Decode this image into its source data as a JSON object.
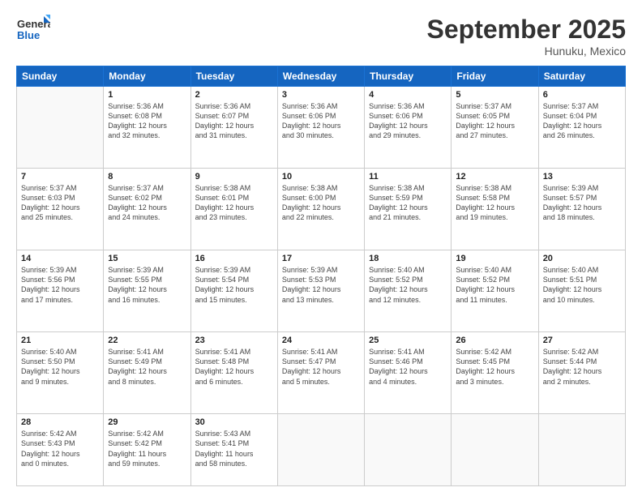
{
  "logo": {
    "line1": "General",
    "line2": "Blue"
  },
  "title": "September 2025",
  "location": "Hunuku, Mexico",
  "days_header": [
    "Sunday",
    "Monday",
    "Tuesday",
    "Wednesday",
    "Thursday",
    "Friday",
    "Saturday"
  ],
  "weeks": [
    [
      {
        "day": "",
        "info": ""
      },
      {
        "day": "1",
        "info": "Sunrise: 5:36 AM\nSunset: 6:08 PM\nDaylight: 12 hours\nand 32 minutes."
      },
      {
        "day": "2",
        "info": "Sunrise: 5:36 AM\nSunset: 6:07 PM\nDaylight: 12 hours\nand 31 minutes."
      },
      {
        "day": "3",
        "info": "Sunrise: 5:36 AM\nSunset: 6:06 PM\nDaylight: 12 hours\nand 30 minutes."
      },
      {
        "day": "4",
        "info": "Sunrise: 5:36 AM\nSunset: 6:06 PM\nDaylight: 12 hours\nand 29 minutes."
      },
      {
        "day": "5",
        "info": "Sunrise: 5:37 AM\nSunset: 6:05 PM\nDaylight: 12 hours\nand 27 minutes."
      },
      {
        "day": "6",
        "info": "Sunrise: 5:37 AM\nSunset: 6:04 PM\nDaylight: 12 hours\nand 26 minutes."
      }
    ],
    [
      {
        "day": "7",
        "info": "Sunrise: 5:37 AM\nSunset: 6:03 PM\nDaylight: 12 hours\nand 25 minutes."
      },
      {
        "day": "8",
        "info": "Sunrise: 5:37 AM\nSunset: 6:02 PM\nDaylight: 12 hours\nand 24 minutes."
      },
      {
        "day": "9",
        "info": "Sunrise: 5:38 AM\nSunset: 6:01 PM\nDaylight: 12 hours\nand 23 minutes."
      },
      {
        "day": "10",
        "info": "Sunrise: 5:38 AM\nSunset: 6:00 PM\nDaylight: 12 hours\nand 22 minutes."
      },
      {
        "day": "11",
        "info": "Sunrise: 5:38 AM\nSunset: 5:59 PM\nDaylight: 12 hours\nand 21 minutes."
      },
      {
        "day": "12",
        "info": "Sunrise: 5:38 AM\nSunset: 5:58 PM\nDaylight: 12 hours\nand 19 minutes."
      },
      {
        "day": "13",
        "info": "Sunrise: 5:39 AM\nSunset: 5:57 PM\nDaylight: 12 hours\nand 18 minutes."
      }
    ],
    [
      {
        "day": "14",
        "info": "Sunrise: 5:39 AM\nSunset: 5:56 PM\nDaylight: 12 hours\nand 17 minutes."
      },
      {
        "day": "15",
        "info": "Sunrise: 5:39 AM\nSunset: 5:55 PM\nDaylight: 12 hours\nand 16 minutes."
      },
      {
        "day": "16",
        "info": "Sunrise: 5:39 AM\nSunset: 5:54 PM\nDaylight: 12 hours\nand 15 minutes."
      },
      {
        "day": "17",
        "info": "Sunrise: 5:39 AM\nSunset: 5:53 PM\nDaylight: 12 hours\nand 13 minutes."
      },
      {
        "day": "18",
        "info": "Sunrise: 5:40 AM\nSunset: 5:52 PM\nDaylight: 12 hours\nand 12 minutes."
      },
      {
        "day": "19",
        "info": "Sunrise: 5:40 AM\nSunset: 5:52 PM\nDaylight: 12 hours\nand 11 minutes."
      },
      {
        "day": "20",
        "info": "Sunrise: 5:40 AM\nSunset: 5:51 PM\nDaylight: 12 hours\nand 10 minutes."
      }
    ],
    [
      {
        "day": "21",
        "info": "Sunrise: 5:40 AM\nSunset: 5:50 PM\nDaylight: 12 hours\nand 9 minutes."
      },
      {
        "day": "22",
        "info": "Sunrise: 5:41 AM\nSunset: 5:49 PM\nDaylight: 12 hours\nand 8 minutes."
      },
      {
        "day": "23",
        "info": "Sunrise: 5:41 AM\nSunset: 5:48 PM\nDaylight: 12 hours\nand 6 minutes."
      },
      {
        "day": "24",
        "info": "Sunrise: 5:41 AM\nSunset: 5:47 PM\nDaylight: 12 hours\nand 5 minutes."
      },
      {
        "day": "25",
        "info": "Sunrise: 5:41 AM\nSunset: 5:46 PM\nDaylight: 12 hours\nand 4 minutes."
      },
      {
        "day": "26",
        "info": "Sunrise: 5:42 AM\nSunset: 5:45 PM\nDaylight: 12 hours\nand 3 minutes."
      },
      {
        "day": "27",
        "info": "Sunrise: 5:42 AM\nSunset: 5:44 PM\nDaylight: 12 hours\nand 2 minutes."
      }
    ],
    [
      {
        "day": "28",
        "info": "Sunrise: 5:42 AM\nSunset: 5:43 PM\nDaylight: 12 hours\nand 0 minutes."
      },
      {
        "day": "29",
        "info": "Sunrise: 5:42 AM\nSunset: 5:42 PM\nDaylight: 11 hours\nand 59 minutes."
      },
      {
        "day": "30",
        "info": "Sunrise: 5:43 AM\nSunset: 5:41 PM\nDaylight: 11 hours\nand 58 minutes."
      },
      {
        "day": "",
        "info": ""
      },
      {
        "day": "",
        "info": ""
      },
      {
        "day": "",
        "info": ""
      },
      {
        "day": "",
        "info": ""
      }
    ]
  ]
}
